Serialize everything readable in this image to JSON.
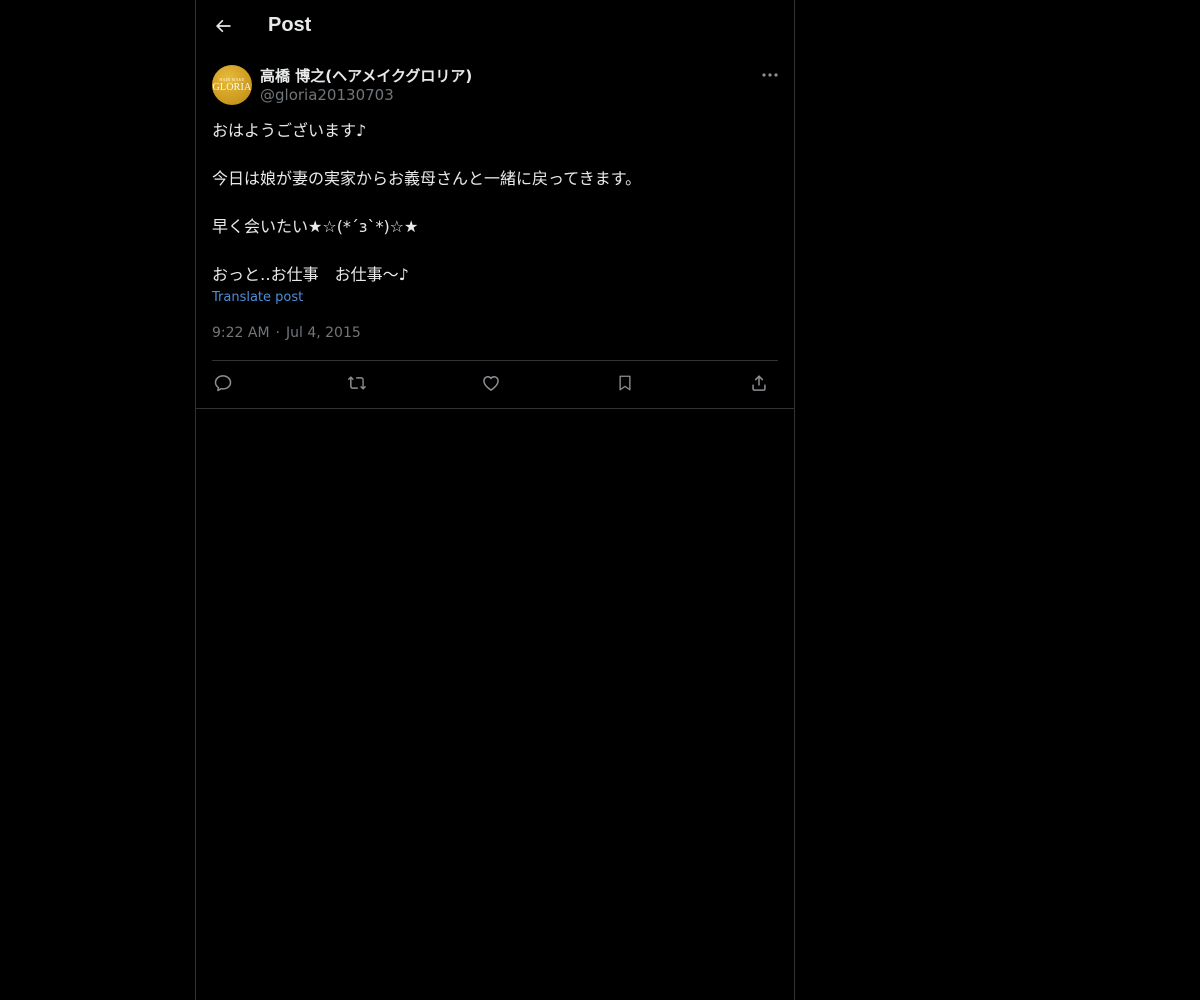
{
  "header": {
    "title": "Post",
    "back_icon": "arrow-left-icon"
  },
  "post": {
    "avatar": {
      "line1": "HAIR MAKE",
      "line2": "GLORIA",
      "color": "#d4a52a"
    },
    "author_name": "高橋 博之(ヘアメイクグロリア)",
    "author_handle": "@gloria20130703",
    "more_icon": "more-horizontal-icon",
    "text_lines": [
      "おはようございます♪",
      "",
      "今日は娘が妻の実家からお義母さんと一緒に戻ってきます。",
      "",
      "早く会いたい★☆(*´з`*)☆★",
      "",
      "おっと‥お仕事　お仕事〜♪"
    ],
    "translate_label": "Translate post",
    "time": "9:22 AM",
    "separator": "·",
    "date": "Jul 4, 2015",
    "actions": [
      {
        "name": "reply",
        "icon": "reply-icon"
      },
      {
        "name": "repost",
        "icon": "repost-icon"
      },
      {
        "name": "like",
        "icon": "heart-icon"
      },
      {
        "name": "bookmark",
        "icon": "bookmark-icon"
      },
      {
        "name": "share",
        "icon": "share-icon"
      }
    ]
  },
  "colors": {
    "background": "#000000",
    "text": "#e7e9ea",
    "muted": "#71767b",
    "link": "#4a8fd8",
    "border": "#2f3336"
  }
}
